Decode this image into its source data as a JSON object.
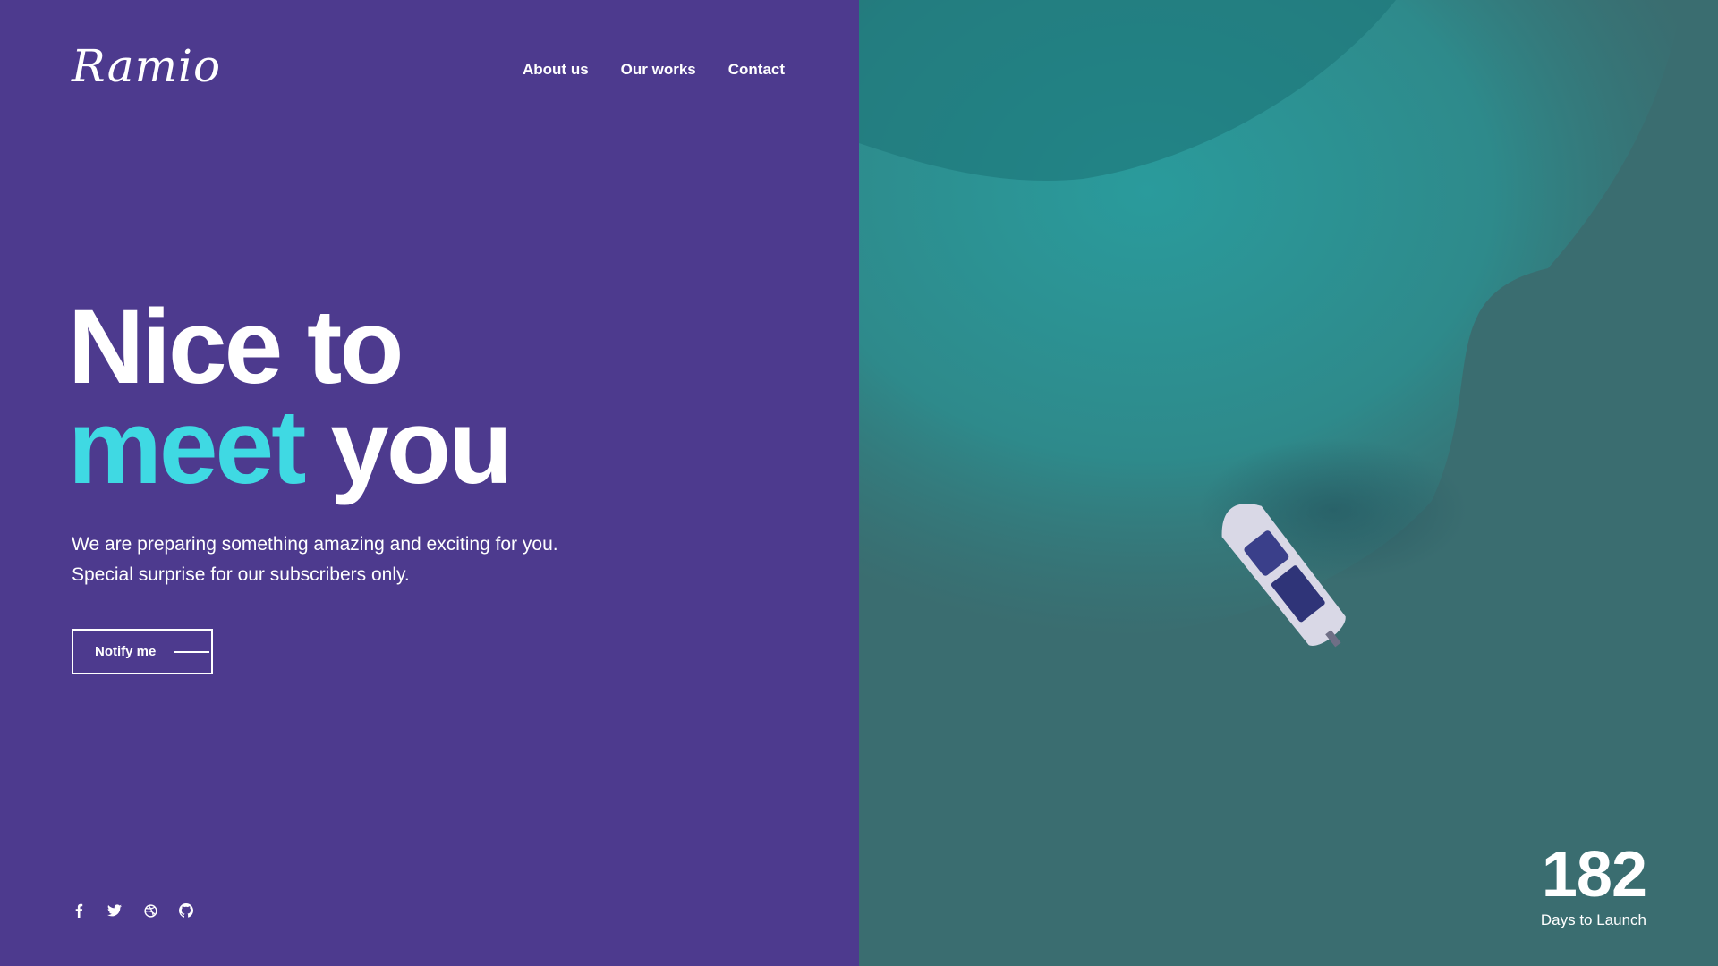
{
  "brand": {
    "logo_text": "Ramio"
  },
  "nav": {
    "items": [
      {
        "label": "About us"
      },
      {
        "label": "Our works"
      },
      {
        "label": "Contact"
      }
    ]
  },
  "hero": {
    "line1": "Nice to",
    "line2_accent": "meet",
    "line2_rest": " you",
    "subtitle": "We are preparing something amazing and exciting for you. Special surprise for our subscribers only.",
    "cta_label": "Notify me"
  },
  "social": [
    {
      "icon": "facebook-icon"
    },
    {
      "icon": "twitter-icon"
    },
    {
      "icon": "dribbble-icon"
    },
    {
      "icon": "github-icon"
    }
  ],
  "countdown": {
    "number": "182",
    "label": "Days to Launch"
  },
  "colors": {
    "left_background": "#4d3a8e",
    "accent": "#3fd9e3",
    "text": "#ffffff",
    "sea": "#2f8688"
  }
}
